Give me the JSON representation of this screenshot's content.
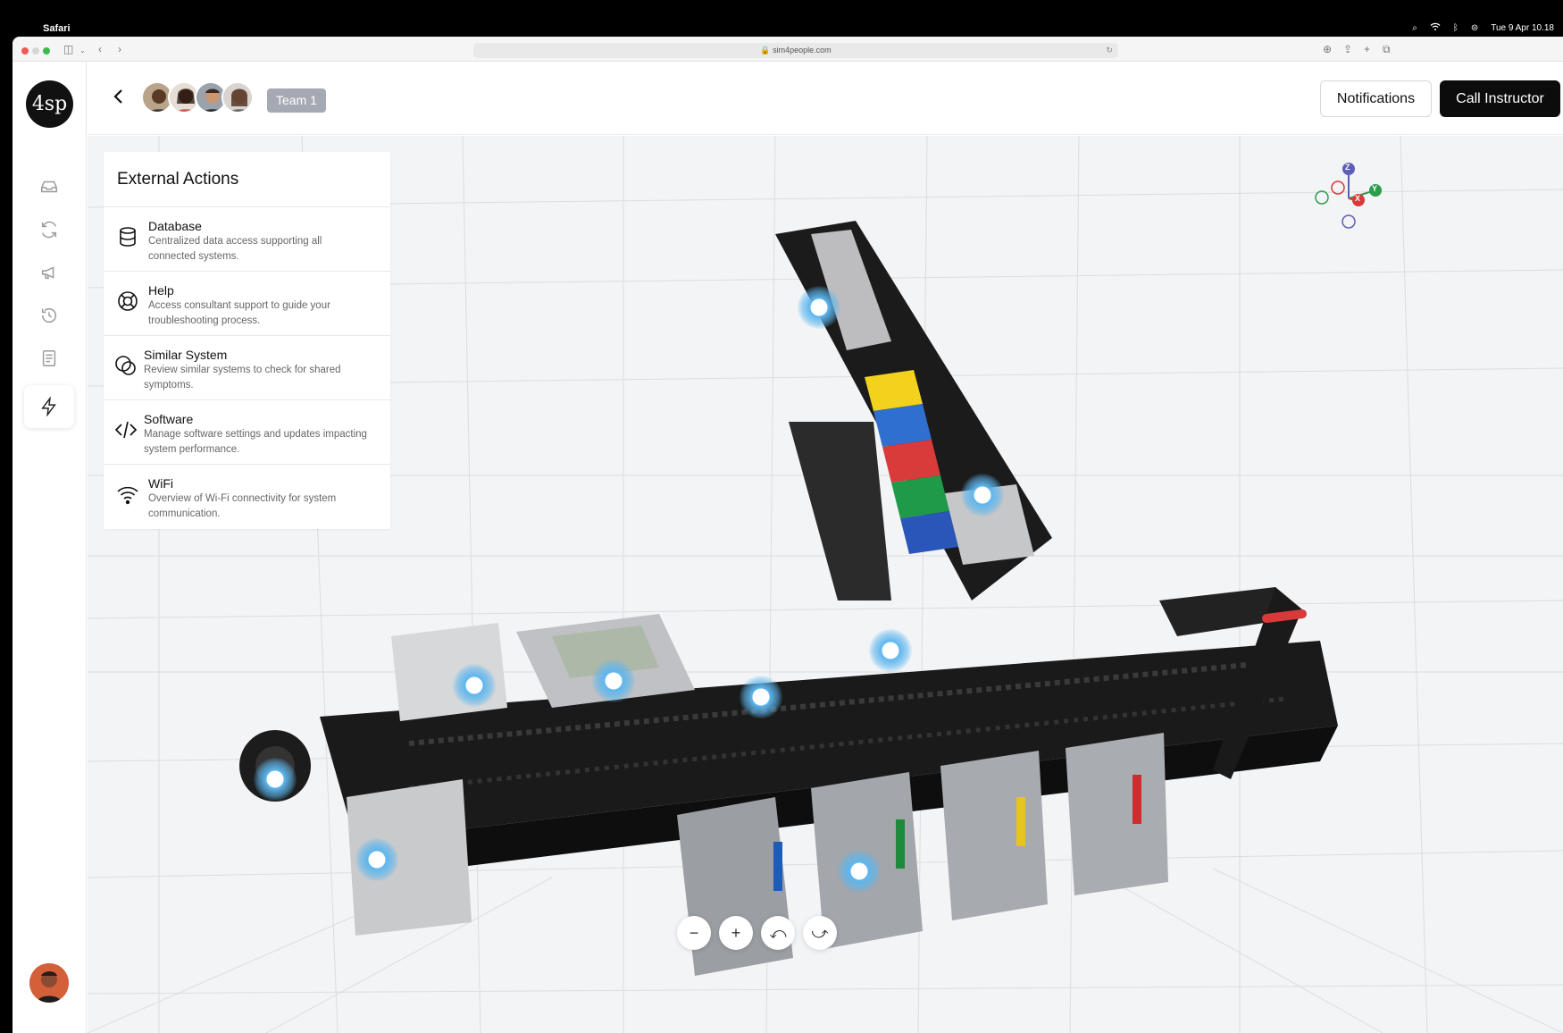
{
  "menubar": {
    "app_name": "Safari",
    "datetime": "Tue 9 Apr  10.18"
  },
  "browser": {
    "url": "sim4people.com"
  },
  "sidebar": {
    "logo_text": "4sp",
    "items": [
      {
        "icon": "inbox-icon"
      },
      {
        "icon": "refresh-icon"
      },
      {
        "icon": "megaphone-icon"
      },
      {
        "icon": "history-icon"
      },
      {
        "icon": "document-icon"
      },
      {
        "icon": "lightning-icon",
        "active": true
      }
    ]
  },
  "header": {
    "team_label": "Team 1",
    "notifications_label": "Notifications",
    "call_instructor_label": "Call Instructor"
  },
  "panel": {
    "title": "External Actions",
    "actions": [
      {
        "title": "Database",
        "description": "Centralized data access supporting all connected systems.",
        "icon": "database-icon"
      },
      {
        "title": "Help",
        "description": "Access consultant support to guide your troubleshooting process.",
        "icon": "lifebuoy-icon"
      },
      {
        "title": "Similar System",
        "description": "Review similar systems to check for shared symptoms.",
        "icon": "overlap-circles-icon"
      },
      {
        "title": "Software",
        "description": "Manage software settings and updates impacting system performance.",
        "icon": "code-icon"
      },
      {
        "title": "WiFi",
        "description": "Overview of Wi-Fi connectivity for system communication.",
        "icon": "wifi-icon"
      }
    ]
  },
  "gizmo": {
    "z": "Z",
    "y": "Y",
    "x": "X"
  },
  "controls": {
    "zoom_out": "−",
    "zoom_in": "+",
    "undo": "⤺",
    "redo": "⤻"
  },
  "colors": {
    "accent_dark": "#0c0c0c",
    "badge": "#a5a9b3",
    "hotspot": "#5db6ee"
  }
}
